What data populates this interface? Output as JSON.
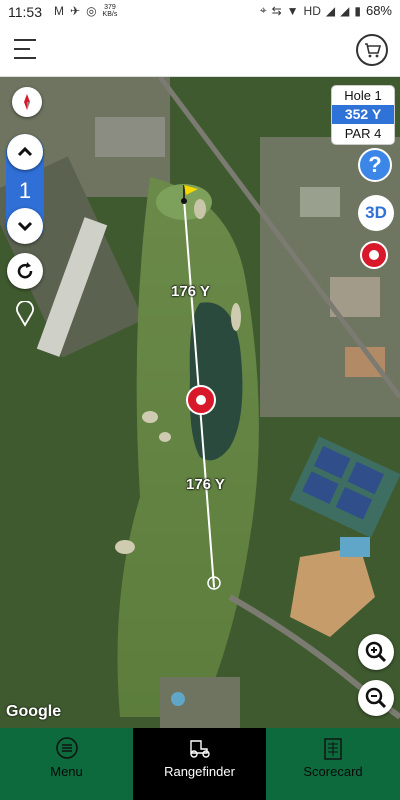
{
  "status_bar": {
    "time": "11:53",
    "speed_value": "379",
    "speed_unit": "KB/s",
    "network": "HD",
    "battery": "68%"
  },
  "hole_info": {
    "hole_label": "Hole 1",
    "distance": "352 Y",
    "par": "PAR 4"
  },
  "map": {
    "current_hole_number": "1",
    "upper_segment_distance": "176 Y",
    "lower_segment_distance": "176 Y",
    "attribution": "Google",
    "button_3d_label": "3D",
    "help_label": "?"
  },
  "bottom_nav": {
    "items": [
      {
        "label": "Menu",
        "icon": "menu-circle-icon",
        "active": false
      },
      {
        "label": "Rangefinder",
        "icon": "golf-cart-icon",
        "active": true
      },
      {
        "label": "Scorecard",
        "icon": "scorecard-icon",
        "active": false
      }
    ]
  },
  "colors": {
    "accent_blue": "#2f72d8",
    "nav_green": "#0d6a3d",
    "marker_red": "#d8192c",
    "flag_yellow": "#f5d800"
  }
}
